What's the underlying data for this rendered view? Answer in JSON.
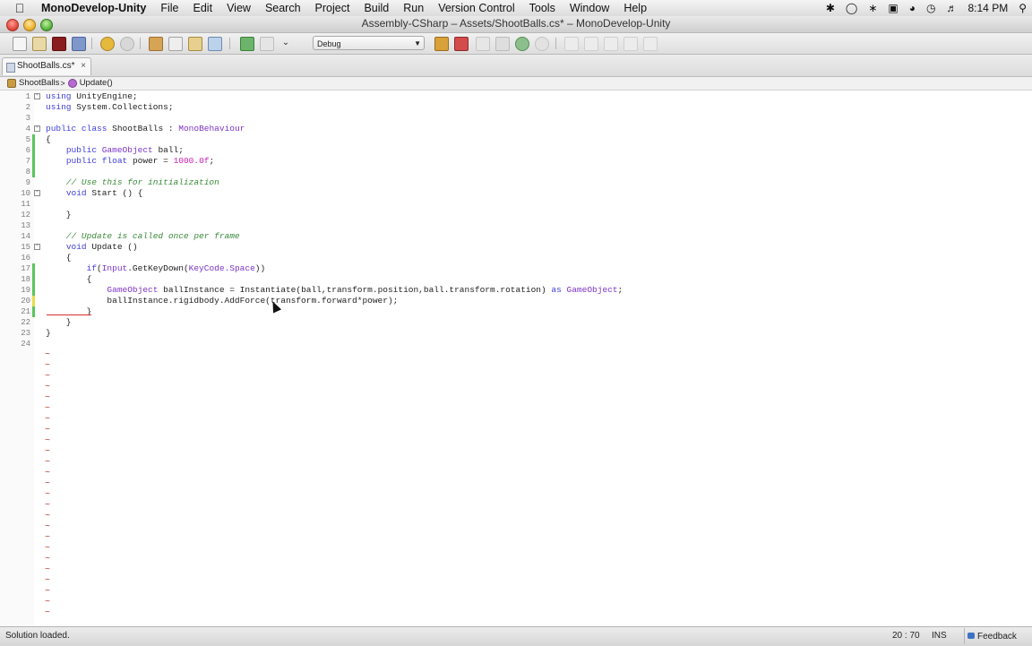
{
  "menubar": {
    "items": [
      "MonoDevelop-Unity",
      "File",
      "Edit",
      "View",
      "Search",
      "Project",
      "Build",
      "Run",
      "Version Control",
      "Tools",
      "Window",
      "Help"
    ],
    "clock": "8:14 PM"
  },
  "window": {
    "title": "Assembly-CSharp – Assets/ShootBalls.cs* – MonoDevelop-Unity"
  },
  "toolbar": {
    "configuration": "Debug"
  },
  "tab": {
    "label": "ShootBalls.cs*",
    "close": "×"
  },
  "breadcrumb": {
    "class_name": "ShootBalls",
    "sep": ">",
    "method_name": "Update()"
  },
  "editor": {
    "lines": [
      {
        "n": "1",
        "code": "using UnityEngine;"
      },
      {
        "n": "2",
        "code": "using System.Collections;"
      },
      {
        "n": "3",
        "code": ""
      },
      {
        "n": "4",
        "code": "public class ShootBalls : MonoBehaviour"
      },
      {
        "n": "5",
        "code": "{"
      },
      {
        "n": "6",
        "code": "    public GameObject ball;"
      },
      {
        "n": "7",
        "code": "    public float power = 1000.0f;"
      },
      {
        "n": "8",
        "code": ""
      },
      {
        "n": "9",
        "code": "    // Use this for initialization"
      },
      {
        "n": "10",
        "code": "    void Start () {"
      },
      {
        "n": "11",
        "code": ""
      },
      {
        "n": "12",
        "code": "    }"
      },
      {
        "n": "13",
        "code": ""
      },
      {
        "n": "14",
        "code": "    // Update is called once per frame"
      },
      {
        "n": "15",
        "code": "    void Update ()"
      },
      {
        "n": "16",
        "code": "    {"
      },
      {
        "n": "17",
        "code": "        if(Input.GetKeyDown(KeyCode.Space))"
      },
      {
        "n": "18",
        "code": "        {"
      },
      {
        "n": "19",
        "code": "            GameObject ballInstance = Instantiate(ball,transform.position,ball.transform.rotation) as GameObject;"
      },
      {
        "n": "20",
        "code": "            ballInstance.rigidbody.AddForce(transform.forward*power);"
      },
      {
        "n": "21",
        "code": "        }"
      },
      {
        "n": "22",
        "code": "    }"
      },
      {
        "n": "23",
        "code": "}"
      },
      {
        "n": "24",
        "code": ""
      }
    ],
    "tilde": "~"
  },
  "statusbar": {
    "message": "Solution loaded.",
    "position": "20 : 70",
    "mode": "INS",
    "feedback": "Feedback"
  }
}
